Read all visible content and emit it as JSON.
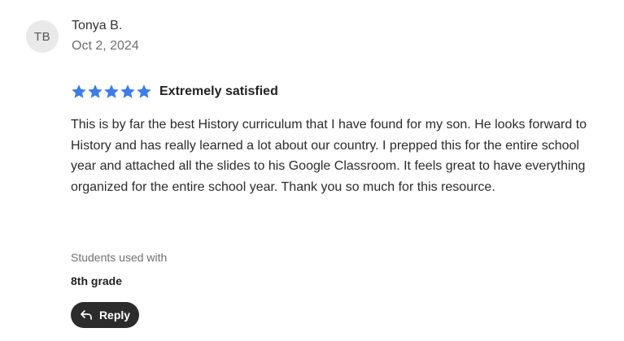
{
  "review": {
    "avatar_initials": "TB",
    "author_name": "Tonya B.",
    "date": "Oct 2, 2024",
    "rating": 5,
    "rating_max": 5,
    "rating_label": "Extremely satisfied",
    "body": "This is by far the best History curriculum that I have found for my son. He looks forward to History and has really learned a lot about our country. I prepped this for the entire school year and attached all the slides to his Google Classroom. It feels great to have everything organized for the entire school year. Thank you so much for this resource.",
    "students_used_with_label": "Students used with",
    "grade": "8th grade",
    "reply_label": "Reply",
    "reply_icon": "reply-arrow-icon",
    "star_icon": "star-icon"
  },
  "colors": {
    "star": "#3d7ee6",
    "reply_button_bg": "#2c2c2c",
    "avatar_bg": "#e9e9e9"
  }
}
